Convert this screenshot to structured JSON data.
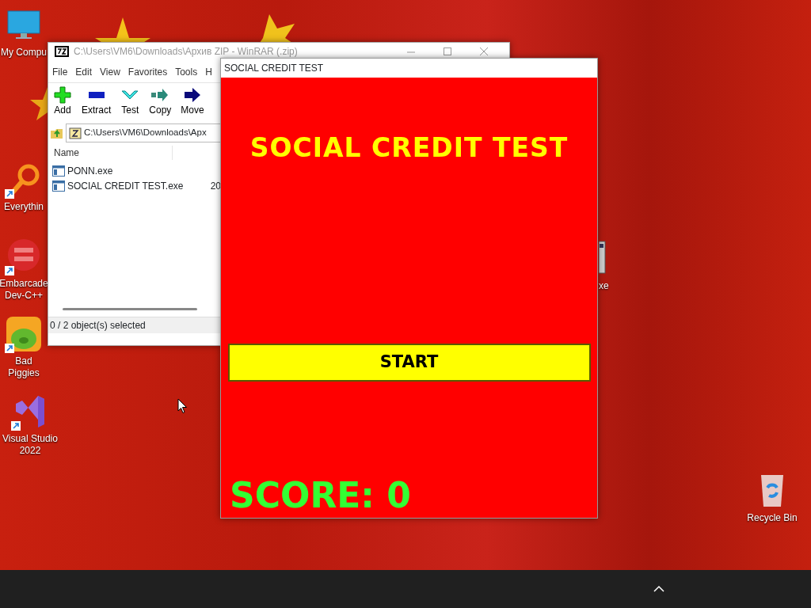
{
  "desktop_icons": [
    {
      "kind": "computer",
      "label": "My Compu",
      "shortcut": false
    },
    {
      "kind": "search",
      "label": "Everythin",
      "shortcut": true
    },
    {
      "kind": "devcpp",
      "label": "Embarcade Dev-C++",
      "shortcut": true
    },
    {
      "kind": "game",
      "label": "Bad Piggies",
      "shortcut": true
    },
    {
      "kind": "studio",
      "label": "Visual Studio 2022",
      "shortcut": true
    },
    {
      "kind": "program",
      "label": "xe",
      "shortcut": false
    },
    {
      "kind": "recycle",
      "label": "Recycle Bin",
      "shortcut": false
    }
  ],
  "archiver": {
    "title": "C:\\Users\\VM6\\Downloads\\Архив ZIP - WinRAR (.zip)",
    "menu": [
      "File",
      "Edit",
      "View",
      "Favorites",
      "Tools",
      "H"
    ],
    "toolbar": [
      {
        "kind": "add",
        "label": "Add"
      },
      {
        "kind": "extract",
        "label": "Extract"
      },
      {
        "kind": "test",
        "label": "Test"
      },
      {
        "kind": "copy",
        "label": "Copy"
      },
      {
        "kind": "move",
        "label": "Move"
      }
    ],
    "address": "C:\\Users\\VM6\\Downloads\\Apx",
    "columns": [
      "Name"
    ],
    "files": [
      {
        "name": "PONN.exe"
      },
      {
        "name": "SOCIAL CREDIT TEST.exe",
        "size": "20"
      }
    ],
    "status": "0 / 2 object(s) selected"
  },
  "game": {
    "title": "SOCIAL CREDIT TEST",
    "heading": "SOCIAL CREDIT TEST",
    "button": "START",
    "score": "SCORE: 0"
  }
}
